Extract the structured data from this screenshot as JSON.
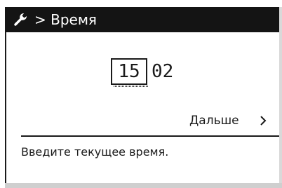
{
  "header": {
    "icon": "wrench-icon",
    "breadcrumb_title": "> Время"
  },
  "time": {
    "hours": "15",
    "minutes": "02"
  },
  "navigation": {
    "next_label": "Дальше",
    "next_icon": "chevron-right-icon"
  },
  "info": {
    "text": "Введите текущее время."
  },
  "colors": {
    "header_background": "#141414",
    "header_text": "#ffffff",
    "text": "#1a1a1a",
    "background": "#ffffff"
  }
}
